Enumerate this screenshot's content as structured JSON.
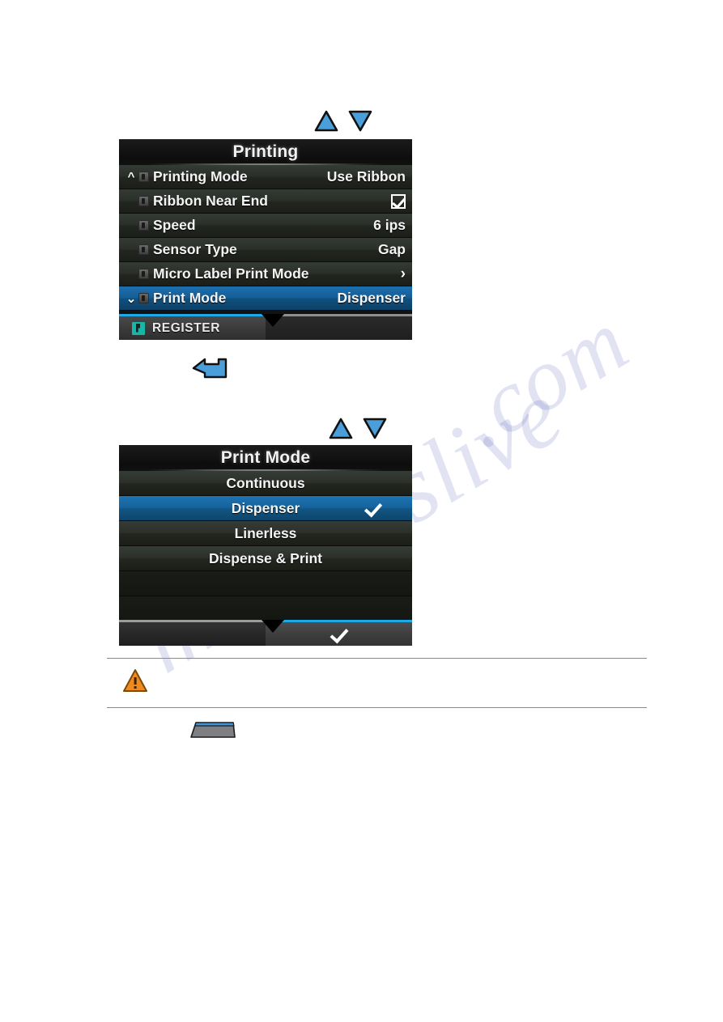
{
  "page": {
    "watermark_line_1": "manualslive",
    "watermark_line_2": ".com"
  },
  "step_keys": {
    "nav_up_icon": "triangle-up-icon",
    "nav_down_icon": "triangle-down-icon",
    "enter_icon": "enter-return-key-icon",
    "gray_key_icon": "gray-key-icon"
  },
  "printing_screen": {
    "title": "Printing",
    "rows": [
      {
        "chevron": "^",
        "lock": true,
        "label": "Printing Mode",
        "value": "Use Ribbon",
        "kind": "value",
        "selected": false
      },
      {
        "chevron": "",
        "lock": true,
        "label": "Ribbon Near End",
        "value": "",
        "kind": "check",
        "selected": false
      },
      {
        "chevron": "",
        "lock": true,
        "label": "Speed",
        "value": "6 ips",
        "kind": "value",
        "selected": false
      },
      {
        "chevron": "",
        "lock": true,
        "label": "Sensor Type",
        "value": "Gap",
        "kind": "value",
        "selected": false
      },
      {
        "chevron": "",
        "lock": true,
        "label": "Micro Label Print Mode",
        "value": "›",
        "kind": "arrow",
        "selected": false
      },
      {
        "chevron": "v",
        "lock": true,
        "label": "Print Mode",
        "value": "Dispenser",
        "kind": "value",
        "selected": true
      }
    ],
    "footer": {
      "left_tab_label": "REGISTER",
      "left_tab_icon": "register-icon",
      "right_tab_label": ""
    }
  },
  "print_mode_screen": {
    "title": "Print Mode",
    "options": [
      {
        "label": "Continuous",
        "selected": false,
        "checked": false
      },
      {
        "label": "Dispenser",
        "selected": true,
        "checked": true
      },
      {
        "label": "Linerless",
        "selected": false,
        "checked": false
      },
      {
        "label": "Dispense & Print",
        "selected": false,
        "checked": false
      },
      {
        "label": "",
        "selected": false,
        "checked": false
      },
      {
        "label": "",
        "selected": false,
        "checked": false
      }
    ],
    "footer": {
      "left_tab_label": "",
      "right_tab_label": "",
      "right_tab_icon": "checkmark-icon"
    }
  },
  "caution": {
    "icon": "warning-triangle-icon",
    "text": ""
  },
  "colors": {
    "accent_blue": "#1fa8e8",
    "selection_blue": "#16629c",
    "warning_orange": "#f08a1e",
    "register_teal": "#17b7a8",
    "lcd_background": "#121212"
  }
}
